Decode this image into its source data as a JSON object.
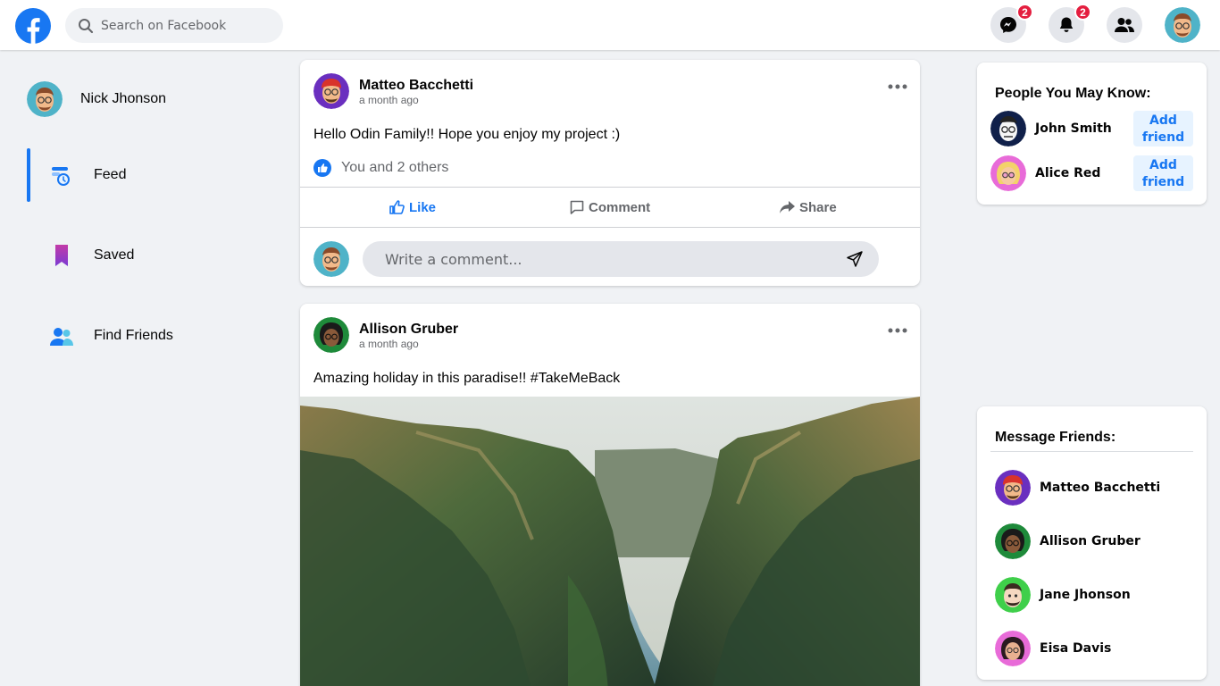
{
  "header": {
    "search_placeholder": "Search on Facebook",
    "messenger_badge": "2",
    "notifications_badge": "2"
  },
  "colors": {
    "brand_blue": "#1877f2",
    "badge_red": "#e41e3f",
    "background": "#f0f2f5"
  },
  "sidebar": {
    "user_name": "Nick Jhonson",
    "items": [
      {
        "label": "Feed",
        "icon": "feed-icon",
        "active": true
      },
      {
        "label": "Saved",
        "icon": "bookmark-icon",
        "active": false
      },
      {
        "label": "Find Friends",
        "icon": "friends-icon",
        "active": false
      }
    ]
  },
  "posts": [
    {
      "author": "Matteo Bacchetti",
      "time": "a month ago",
      "text": "Hello Odin Family!! Hope you enjoy my project :)",
      "likes_text": "You and 2 others",
      "actions": {
        "like": "Like",
        "comment": "Comment",
        "share": "Share"
      },
      "comment_placeholder": "Write a comment..."
    },
    {
      "author": "Allison Gruber",
      "time": "a month ago",
      "text": "Amazing holiday in this paradise!! #TakeMeBack",
      "image": "canyon-landscape-photo"
    }
  ],
  "people_you_may_know": {
    "title": "People You May Know:",
    "add_label": "Add friend",
    "people": [
      {
        "name": "John Smith"
      },
      {
        "name": "Alice Red"
      }
    ]
  },
  "message_friends": {
    "title": "Message Friends:",
    "friends": [
      {
        "name": "Matteo Bacchetti"
      },
      {
        "name": "Allison Gruber"
      },
      {
        "name": "Jane Jhonson"
      },
      {
        "name": "Eisa Davis"
      }
    ]
  }
}
